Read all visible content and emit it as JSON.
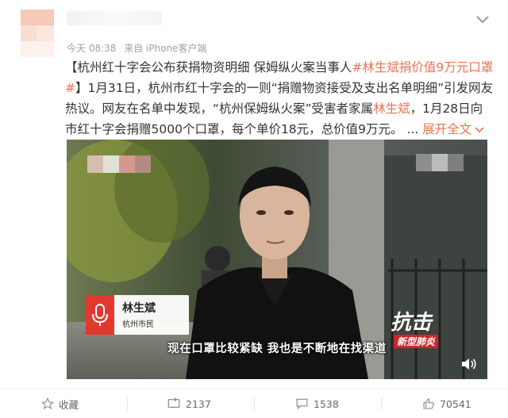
{
  "post": {
    "time": "今天 08:38",
    "source": "来自 iPhone客户端",
    "text": {
      "open": "【杭州红十字会公布获捐物资明细 保姆纵火案当事人",
      "hashtag": "#林生斌捐价值9万元口罩#",
      "p1": "】1月31日，杭州市红十字会的一则“捐赠物资接受及支出名单明细”引发网友热议。网友在名单中发现，“杭州保姆纵火案”受害者家属",
      "name": "林生斌",
      "p2": "，1月28日向市红十字会捐赠5000个口罩，每个单价18元，总价值9万元。 ... ",
      "expand": "展开全文"
    }
  },
  "video": {
    "caption_name": "林生斌",
    "caption_role": "杭州市民",
    "subtitle": "现在口罩比较紧缺 我也是不断地在找渠道",
    "logo_top": "抗击",
    "logo_bottom": "新型肺炎"
  },
  "actions": {
    "favorite": "收藏",
    "repost": "2137",
    "comment": "1538",
    "like": "70541"
  },
  "colors": {
    "accent": "#eb7350",
    "mic_red": "#e03a2e"
  }
}
